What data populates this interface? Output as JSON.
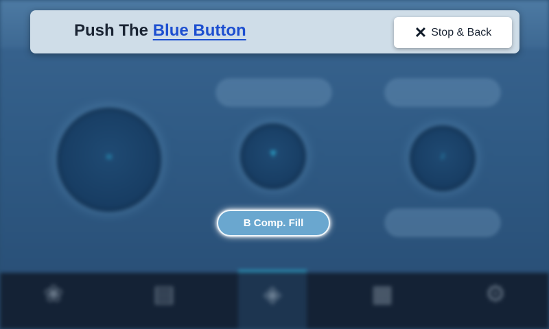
{
  "banner": {
    "prefix": "Push The",
    "highlight": "Blue Button",
    "stop_button": {
      "icon": "close-icon",
      "label": "Stop & Back"
    }
  },
  "background_ghosts": {
    "top_right_text": "",
    "pill_top_middle": "",
    "pill_top_right": "",
    "pill_bottom_right": "",
    "circles": [
      {
        "name": "a-comp-mixing",
        "line1": "",
        "line2": "",
        "icon": "mixing-icon"
      },
      {
        "name": "resin-fill",
        "line1": "",
        "line2": "",
        "icon": "funnel-icon"
      },
      {
        "name": "clean",
        "line1": "",
        "line2": "",
        "icon": "brush-icon"
      }
    ]
  },
  "target_button": {
    "label": "B Comp. Fill",
    "color": "#6aa7cf"
  },
  "nav": {
    "active_index": 2,
    "items": [
      {
        "label": "",
        "icon": "print-icon"
      },
      {
        "label": "",
        "icon": "file-icon"
      },
      {
        "label": "",
        "icon": "casting-icon"
      },
      {
        "label": "",
        "icon": "control-icon"
      },
      {
        "label": "",
        "icon": "settings-icon"
      }
    ]
  },
  "colors": {
    "accent": "#1d4fd0",
    "nav_active": "#2aa6c9",
    "background": "#2f5a84"
  }
}
